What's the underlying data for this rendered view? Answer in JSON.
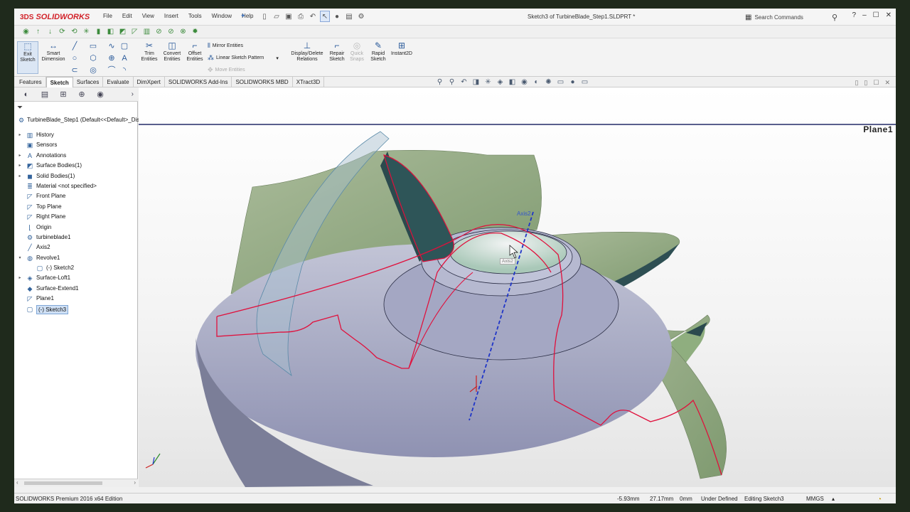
{
  "app": {
    "logo_ds": "3DS",
    "logo_text": "SOLIDWORKS",
    "document_title": "Sketch3 of TurbineBlade_Step1.SLDPRT *"
  },
  "menu": [
    "File",
    "Edit",
    "View",
    "Insert",
    "Tools",
    "Window",
    "Help"
  ],
  "search": {
    "placeholder": "Search Commands"
  },
  "command_manager": {
    "exit_sketch": "Exit\nSketch",
    "smart_dimension": "Smart\nDimension",
    "trim_entities": "Trim\nEntities",
    "convert_entities": "Convert\nEntities",
    "offset_entities": "Offset\nEntities",
    "mirror_entities": "Mirror Entities",
    "linear_sketch_pattern": "Linear Sketch Pattern",
    "move_entities": "Move Entities",
    "display_delete_relations": "Display/Delete\nRelations",
    "repair_sketch": "Repair\nSketch",
    "quick_snaps": "Quick\nSnaps",
    "rapid_sketch": "Rapid\nSketch",
    "instant2d": "Instant2D"
  },
  "tabs": [
    "Features",
    "Sketch",
    "Surfaces",
    "Evaluate",
    "DimXpert",
    "SOLIDWORKS Add-Ins",
    "SOLIDWORKS MBD",
    "XTract3D"
  ],
  "active_tab": "Sketch",
  "feature_tree": {
    "root": "TurbineBlade_Step1  (Default<<Default>_Dis",
    "items": [
      {
        "label": "History",
        "expander": "▸",
        "icon": "history-icon"
      },
      {
        "label": "Sensors",
        "expander": "",
        "icon": "sensors-icon"
      },
      {
        "label": "Annotations",
        "expander": "▸",
        "icon": "annotations-icon"
      },
      {
        "label": "Surface Bodies(1)",
        "expander": "▸",
        "icon": "surface-bodies-icon"
      },
      {
        "label": "Solid Bodies(1)",
        "expander": "▸",
        "icon": "solid-bodies-icon"
      },
      {
        "label": "Material <not specified>",
        "expander": "",
        "icon": "material-icon"
      },
      {
        "label": "Front Plane",
        "expander": "",
        "icon": "plane-icon"
      },
      {
        "label": "Top Plane",
        "expander": "",
        "icon": "plane-icon"
      },
      {
        "label": "Right Plane",
        "expander": "",
        "icon": "plane-icon"
      },
      {
        "label": "Origin",
        "expander": "",
        "icon": "origin-icon"
      },
      {
        "label": "turbineblade1",
        "expander": "",
        "icon": "part-icon"
      },
      {
        "label": "Axis2",
        "expander": "",
        "icon": "axis-icon"
      },
      {
        "label": "Revolve1",
        "expander": "▾",
        "icon": "revolve-icon"
      },
      {
        "label": "(-) Sketch2",
        "expander": "",
        "icon": "sketch-icon",
        "child": true
      },
      {
        "label": "Surface-Loft1",
        "expander": "▸",
        "icon": "surface-loft-icon"
      },
      {
        "label": "Surface-Extend1",
        "expander": "",
        "icon": "surface-extend-icon"
      },
      {
        "label": "Plane1",
        "expander": "",
        "icon": "plane-icon"
      },
      {
        "label": "(-) Sketch3",
        "expander": "",
        "icon": "sketch-icon",
        "selected": true
      }
    ]
  },
  "viewport": {
    "plane_label": "Plane1",
    "axis_label": "Axis2",
    "cursor_tag": "Axis2"
  },
  "status_bar": {
    "edition": "SOLIDWORKS Premium 2016 x64 Edition",
    "x": "-5.93mm",
    "y": "27.17mm",
    "z": "0mm",
    "definition": "Under Defined",
    "mode": "Editing Sketch3",
    "units": "MMGS"
  },
  "colors": {
    "sketch_line": "#e0103c",
    "axis_line": "#1f35c8",
    "blade": "#8aa27c",
    "hub": "#9ea0bd"
  }
}
